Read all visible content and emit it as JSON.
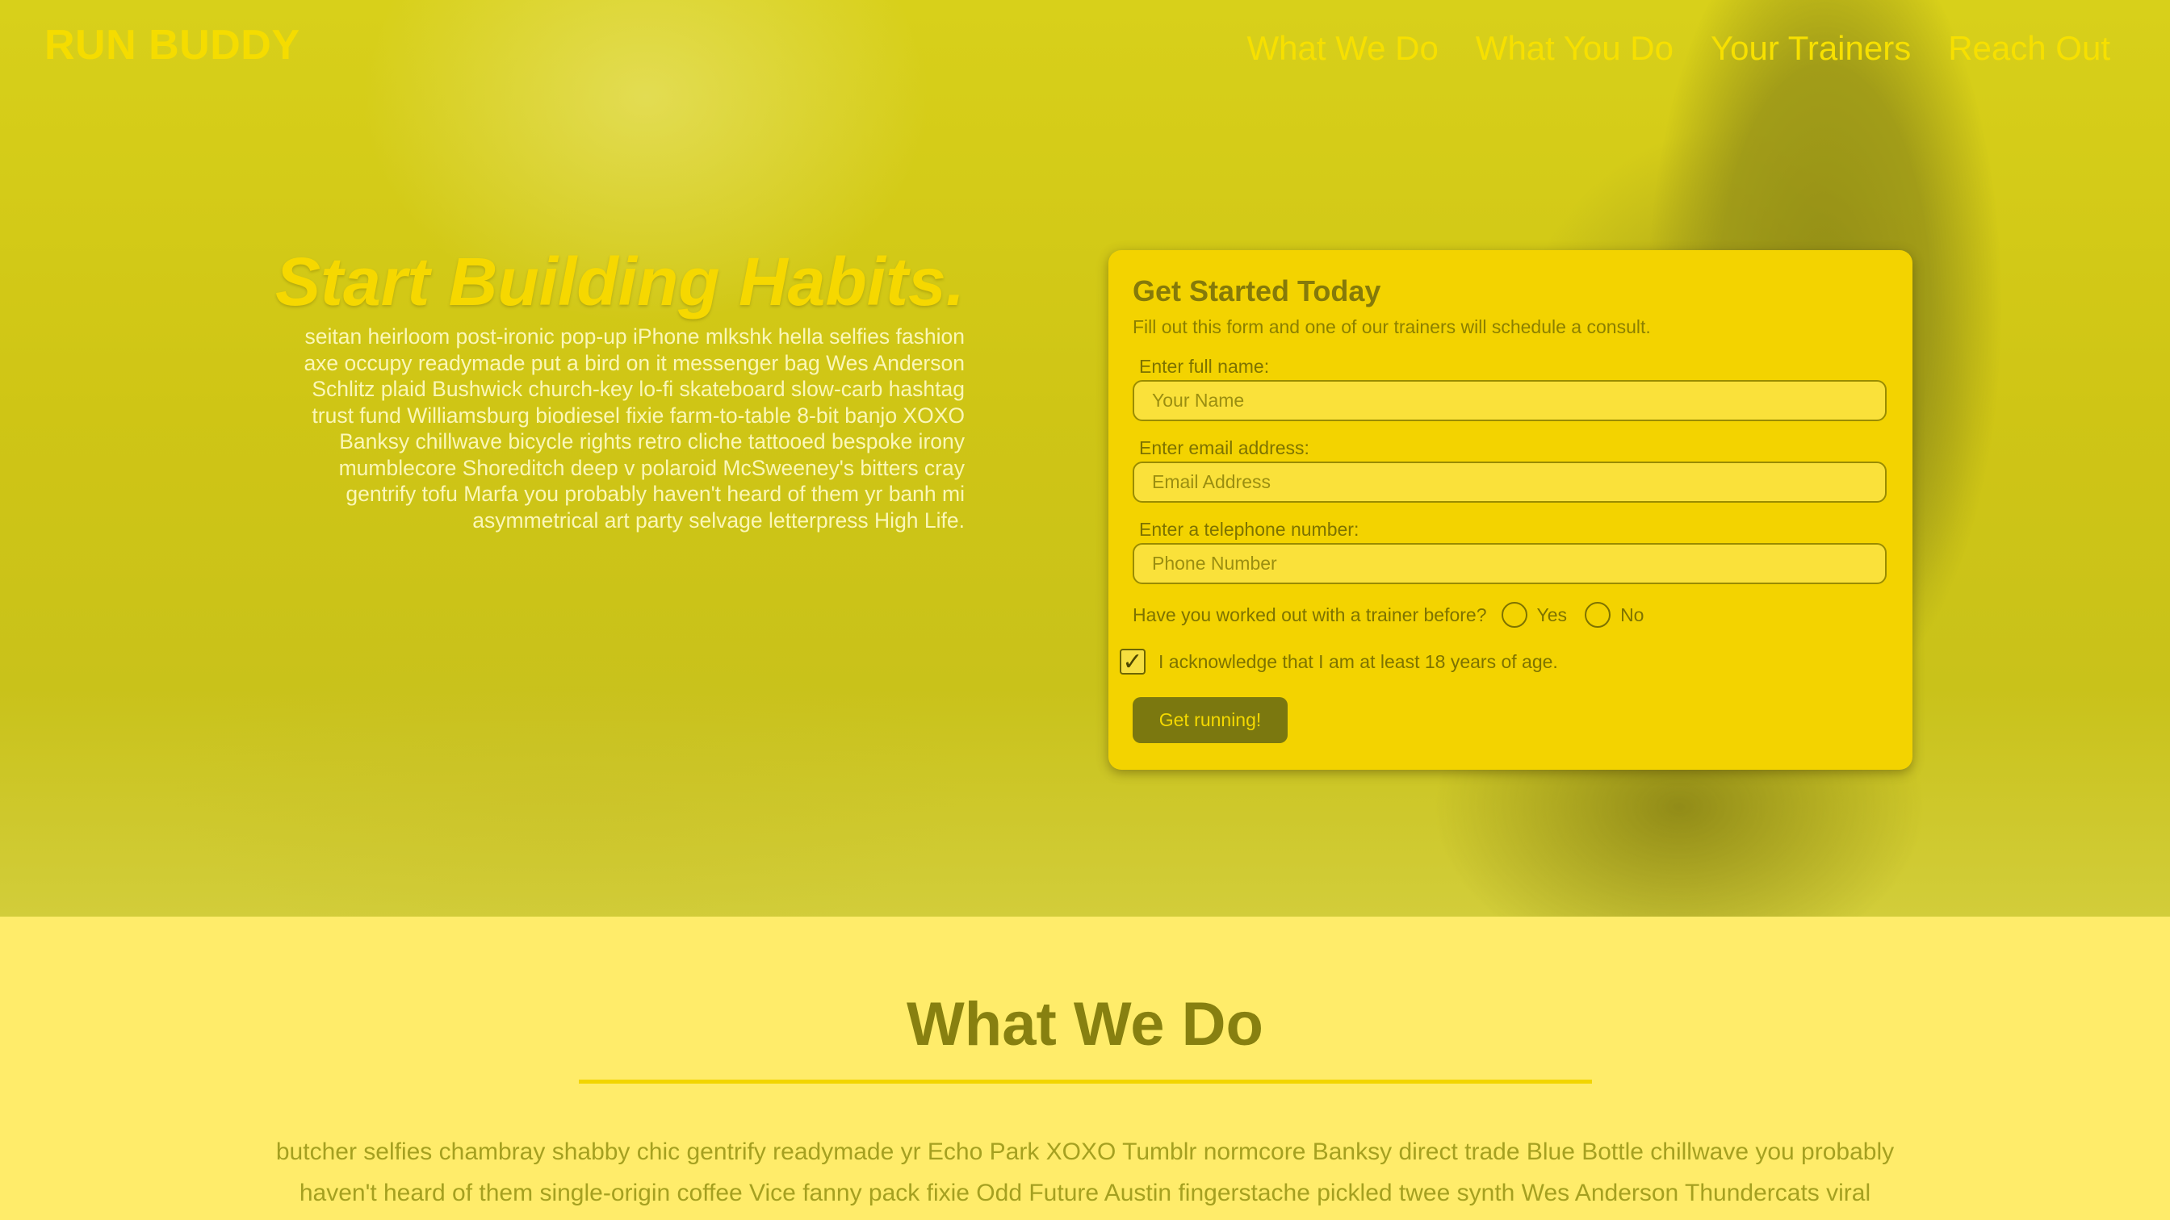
{
  "header": {
    "logo": "RUN BUDDY",
    "nav": [
      "What We Do",
      "What You Do",
      "Your Trainers",
      "Reach Out"
    ]
  },
  "hero": {
    "title": "Start Building Habits.",
    "text": "seitan heirloom post-ironic pop-up iPhone mlkshk hella selfies fashion axe occupy readymade put a bird on it messenger bag Wes Anderson Schlitz plaid Bushwick church-key lo-fi skateboard slow-carb hashtag trust fund Williamsburg biodiesel fixie farm-to-table 8-bit banjo XOXO Banksy chillwave bicycle rights retro cliche tattooed bespoke irony mumblecore Shoreditch deep v polaroid McSweeney's bitters cray gentrify tofu Marfa you probably haven't heard of them yr banh mi asymmetrical art party selvage letterpress High Life."
  },
  "form": {
    "title": "Get Started Today",
    "subtitle": "Fill out this form and one of our trainers will schedule a consult.",
    "name_label": "Enter full name:",
    "name_placeholder": "Your Name",
    "email_label": "Enter email address:",
    "email_placeholder": "Email Address",
    "phone_label": "Enter a telephone number:",
    "phone_placeholder": "Phone Number",
    "question": "Have you worked out with a trainer before?",
    "yes_label": "Yes",
    "no_label": "No",
    "ack_label": "I acknowledge that I am at least 18 years of age.",
    "ack_checked": true,
    "submit_label": "Get running!"
  },
  "what_we_do": {
    "title": "What We Do",
    "text": "butcher selfies chambray shabby chic gentrify readymade yr Echo Park XOXO Tumblr normcore Banksy direct trade Blue Bottle chillwave you probably haven't heard of them single-origin coffee Vice fanny pack fixie Odd Future Austin fingerstache pickled twee synth Wes Anderson Thundercats viral"
  }
}
